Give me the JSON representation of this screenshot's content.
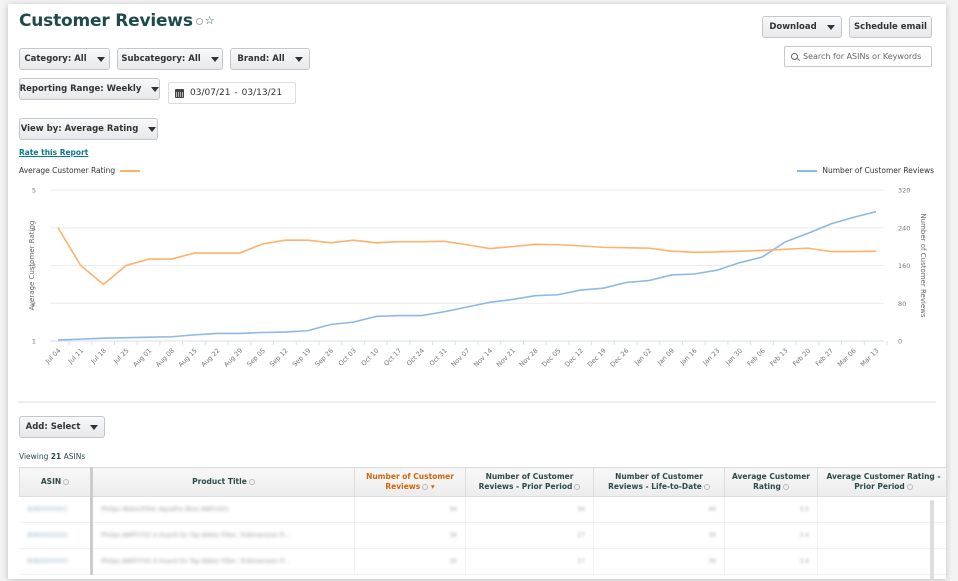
{
  "header": {
    "title": "Customer Reviews",
    "download_label": "Download",
    "schedule_label": "Schedule email",
    "search_placeholder": "Search for ASINs or Keywords"
  },
  "filters": {
    "category": "Category: All",
    "subcategory": "Subcategory: All",
    "brand": "Brand: All",
    "reporting_range": "Reporting Range: Weekly",
    "date_start": "03/07/21",
    "date_sep": "-",
    "date_end": "03/13/21",
    "view_by": "View by: Average Rating",
    "rate_link": "Rate this Report"
  },
  "colors": {
    "rating_line": "#fdb26c",
    "reviews_line": "#8cb8e6",
    "title": "#1f4a4a",
    "sorted_header": "#d0660b",
    "link": "#0a7a8a"
  },
  "chart_data": {
    "type": "line",
    "title": "",
    "legend": [
      {
        "name": "Average Customer Rating",
        "position": "top-left"
      },
      {
        "name": "Number of Customer Reviews",
        "position": "top-right"
      }
    ],
    "x": [
      "Jul 04",
      "Jul 11",
      "Jul 18",
      "Jul 25",
      "Aug 01",
      "Aug 08",
      "Aug 15",
      "Aug 22",
      "Aug 29",
      "Sep 05",
      "Sep 12",
      "Sep 19",
      "Sep 26",
      "Oct 03",
      "Oct 10",
      "Oct 17",
      "Oct 24",
      "Oct 31",
      "Nov 07",
      "Nov 14",
      "Nov 21",
      "Nov 28",
      "Dec 05",
      "Dec 12",
      "Dec 19",
      "Dec 26",
      "Jan 02",
      "Jan 09",
      "Jan 16",
      "Jan 23",
      "Jan 30",
      "Feb 06",
      "Feb 13",
      "Feb 20",
      "Feb 27",
      "Mar 06",
      "Mar 13"
    ],
    "xlabel": "",
    "ylabel": "Average Customer Rating",
    "ylim": [
      1,
      5
    ],
    "yticks": [
      1,
      2,
      3,
      4,
      5
    ],
    "y2label": "Number of Customer Reviews",
    "y2lim": [
      0,
      320
    ],
    "y2ticks": [
      0,
      80,
      160,
      240,
      320
    ],
    "grid": true,
    "series": [
      {
        "name": "Average Customer Rating",
        "axis": "left",
        "values": [
          4.0,
          3.0,
          2.5,
          3.0,
          3.17,
          3.17,
          3.33,
          3.33,
          3.33,
          3.57,
          3.67,
          3.67,
          3.6,
          3.67,
          3.6,
          3.63,
          3.63,
          3.64,
          3.55,
          3.45,
          3.5,
          3.56,
          3.55,
          3.52,
          3.48,
          3.47,
          3.46,
          3.38,
          3.35,
          3.36,
          3.38,
          3.4,
          3.43,
          3.46,
          3.37,
          3.37,
          3.38
        ]
      },
      {
        "name": "Number of Customer Reviews",
        "axis": "right",
        "values": [
          2,
          4,
          6,
          7,
          8,
          9,
          13,
          16,
          16,
          18,
          19,
          22,
          35,
          40,
          52,
          54,
          54,
          62,
          72,
          82,
          88,
          96,
          98,
          108,
          112,
          124,
          128,
          140,
          142,
          150,
          166,
          178,
          210,
          228,
          248,
          262,
          274
        ]
      }
    ]
  },
  "table": {
    "add_label": "Add: Select",
    "viewing_prefix": "Viewing",
    "viewing_count": "21",
    "viewing_suffix": "ASINs",
    "columns": [
      {
        "label": "ASIN"
      },
      {
        "label": "Product Title"
      },
      {
        "label": "Number of Customer Reviews",
        "sorted": true
      },
      {
        "label": "Number of Customer Reviews - Prior Period"
      },
      {
        "label": "Number of Customer Reviews - Life-to-Date"
      },
      {
        "label": "Average Customer Rating"
      },
      {
        "label": "Average Customer Rating - Prior Period"
      }
    ],
    "rows": [
      {
        "asin": "B08XXXXXX1",
        "title": "Philips Water/Filter AquaPro Blue AWP1021",
        "reviews": "30",
        "prior": "30",
        "ltd": "40",
        "rating": "3.5",
        "rating_prior": ""
      },
      {
        "asin": "B08XXXXXX2",
        "title": "Philips AWP3703 X-Guard On Tap Water Filter, Tridimension Fi...",
        "reviews": "30",
        "prior": "27",
        "ltd": "30",
        "rating": "3.4",
        "rating_prior": ""
      },
      {
        "asin": "B08XXXXXX3",
        "title": "Philips AWP3704 X-Guard On Tap Water Filter, Tridimension Fi...",
        "reviews": "30",
        "prior": "27",
        "ltd": "30",
        "rating": "3.4",
        "rating_prior": ""
      }
    ]
  }
}
